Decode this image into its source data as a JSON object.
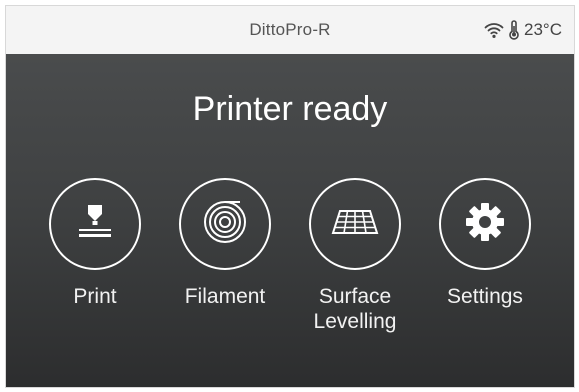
{
  "status_bar": {
    "device_name": "DittoPro-R",
    "temperature": "23°C",
    "icons": [
      "wifi-icon",
      "thermometer-icon"
    ]
  },
  "main": {
    "title": "Printer ready",
    "menu": [
      {
        "label": "Print",
        "icon": "print-nozzle-icon"
      },
      {
        "label": "Filament",
        "icon": "filament-spool-icon"
      },
      {
        "label": "Surface\nLevelling",
        "icon": "bed-grid-icon"
      },
      {
        "label": "Settings",
        "icon": "gear-icon"
      }
    ]
  },
  "colors": {
    "status_bg": "#f4f4f4",
    "main_bg_top": "#4a4c4d",
    "main_bg_bottom": "#2c2d2e",
    "foreground": "#ffffff"
  }
}
